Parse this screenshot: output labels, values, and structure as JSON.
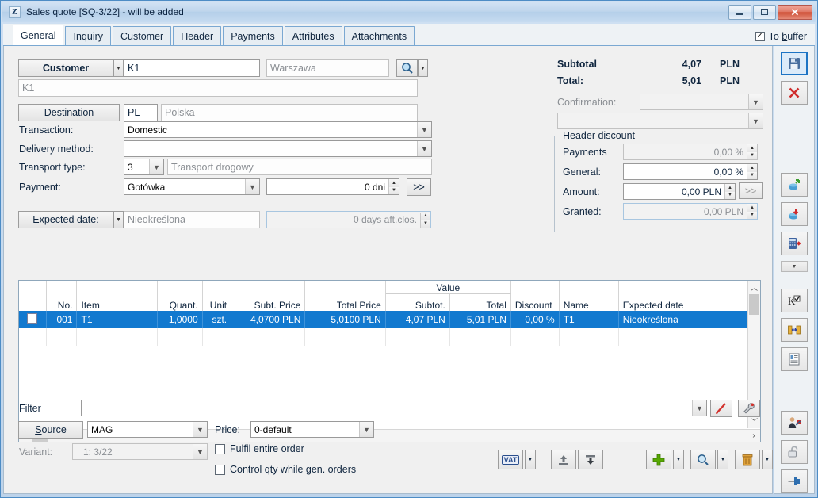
{
  "window": {
    "app_glyph": "Z",
    "title": "Sales quote [SQ-3/22] - will be added",
    "minimize": "minimize-icon",
    "maximize": "maximize-icon",
    "close": "close-icon"
  },
  "tabs": [
    {
      "label": "General",
      "active": true
    },
    {
      "label": "Inquiry",
      "active": false
    },
    {
      "label": "Customer",
      "active": false
    },
    {
      "label": "Header",
      "active": false
    },
    {
      "label": "Payments",
      "active": false
    },
    {
      "label": "Attributes",
      "active": false
    },
    {
      "label": "Attachments",
      "active": false
    }
  ],
  "to_buffer": {
    "label_pre": "To ",
    "label_accel": "b",
    "label_post": "uffer",
    "checked": true,
    "mark": "✓"
  },
  "form": {
    "customer_button": "Customer",
    "customer_code": "K1",
    "customer_city_placeholder": "Warszawa",
    "customer_name_placeholder": "K1",
    "search_icon": "magnifier-icon",
    "destination_button": "Destination",
    "country_code": "PL",
    "country_name": "Polska",
    "transaction_label": "Transaction:",
    "transaction_value": "Domestic",
    "delivery_label": "Delivery method:",
    "delivery_value": "",
    "transport_label": "Transport type:",
    "transport_code": "3",
    "transport_name": "Transport drogowy",
    "payment_label": "Payment:",
    "payment_value": "Gotówka",
    "payment_days": "0 dni",
    "payment_more": ">>",
    "expected_button": "Expected date:",
    "expected_value": "Nieokreślona",
    "expected_days": "0 days aft.clos."
  },
  "summary": {
    "subtotal_label": "Subtotal",
    "subtotal_value": "4,07",
    "subtotal_currency": "PLN",
    "total_label": "Total:",
    "total_value": "5,01",
    "total_currency": "PLN",
    "confirmation_label": "Confirmation:",
    "confirmation_value": "",
    "confirmation_second": ""
  },
  "header_discount": {
    "title": "Header discount",
    "payments_label": "Payments",
    "payments_value": "0,00 %",
    "general_label": "General:",
    "general_value": "0,00 %",
    "amount_label": "Amount:",
    "amount_value": "0,00 PLN",
    "amount_more": ">>",
    "granted_label": "Granted:",
    "granted_value": "0,00 PLN"
  },
  "grid": {
    "group_header": "Value",
    "columns": [
      "No.",
      "Item",
      "Quant.",
      "Unit",
      "Subt. Price",
      "Total Price",
      "Subtot.",
      "Total",
      "Discount",
      "Name",
      "Expected date"
    ],
    "rows": [
      {
        "checked": false,
        "no": "001",
        "item": "T1",
        "quant": "1,0000",
        "unit": "szt.",
        "subt_price": "4,0700 PLN",
        "total_price": "5,0100 PLN",
        "value_subtot": "4,07 PLN",
        "value_total": "5,01 PLN",
        "discount": "0,00 %",
        "name": "T1",
        "expected_date": "Nieokreślona",
        "selected": true
      }
    ]
  },
  "bottom": {
    "filter_label": "Filter",
    "filter_value": "",
    "filter_pen_icon": "red-pen-icon",
    "filter_wrench_icon": "wrench-icon",
    "source_button": "Source",
    "source_accel": "S",
    "source_value": "MAG",
    "price_label": "Price:",
    "price_value": "0-default",
    "variant_label": "Variant:",
    "variant_value": "1:  3/22",
    "fulfil_label": "Fulfil entire order",
    "fulfil_checked": false,
    "control_label": "Control qty while gen. orders",
    "control_checked": false,
    "action_icons": [
      "vat-icon",
      "vat-dropdown-icon",
      "export-up-icon",
      "import-down-icon",
      "add-plus-icon",
      "add-dropdown-icon",
      "search-icon",
      "search-dropdown-icon",
      "delete-trash-icon",
      "delete-dropdown-icon"
    ]
  },
  "right_toolbar": [
    {
      "name": "save-icon",
      "selected": true
    },
    {
      "name": "cancel-close-icon",
      "selected": false
    },
    {
      "name": "import-from-db-icon",
      "selected": false
    },
    {
      "name": "export-to-db-icon",
      "selected": false
    },
    {
      "name": "calculator-icon",
      "selected": false
    },
    {
      "name": "dropdown-more-icon",
      "selected": false
    },
    {
      "name": "correction-icon",
      "selected": false
    },
    {
      "name": "link-documents-icon",
      "selected": false
    },
    {
      "name": "notes-icon",
      "selected": false
    },
    {
      "name": "contact-person-icon",
      "selected": false
    },
    {
      "name": "unlock-icon",
      "selected": false
    },
    {
      "name": "pin-icon",
      "selected": false
    }
  ],
  "colors": {
    "accent": "#1279cf",
    "titlebar": "#bdd3ea",
    "frame_border": "#4d8cc5",
    "close_button": "#cf5138"
  }
}
